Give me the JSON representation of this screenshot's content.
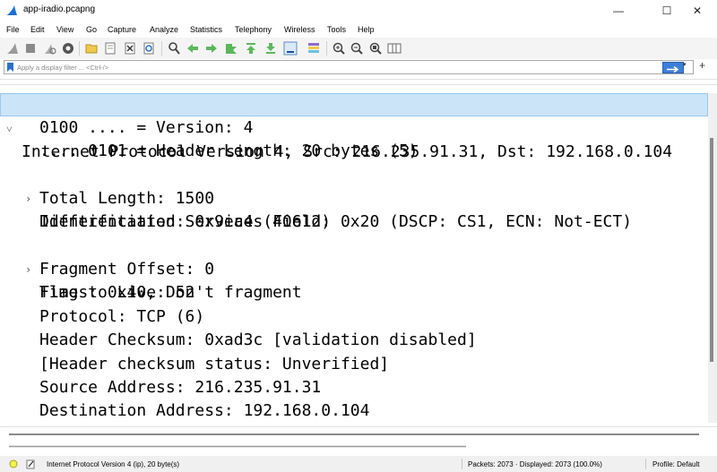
{
  "window": {
    "title": "app-iradio.pcapng",
    "minimize": "—",
    "maximize": "☐",
    "close": "✕"
  },
  "menu": [
    "File",
    "Edit",
    "View",
    "Go",
    "Capture",
    "Analyze",
    "Statistics",
    "Telephony",
    "Wireless",
    "Tools",
    "Help"
  ],
  "filter": {
    "placeholder": "Apply a display filter ... <Ctrl-/>",
    "value": ""
  },
  "details": [
    {
      "text": "Internet Protocol Version 4, Src: 216.235.91.31, Dst: 192.168.0.104",
      "expander": "˅",
      "selected": true
    },
    {
      "text": "0100 .... = Version: 4",
      "expander": ""
    },
    {
      "text": ".... 0101 = Header Length: 20 bytes (5)",
      "expander": ""
    },
    {
      "text": "Differentiated Services Field: 0x20 (DSCP: CS1, ECN: Not-ECT)",
      "expander": "›"
    },
    {
      "text": "Total Length: 1500",
      "expander": ""
    },
    {
      "text": "Identification: 0x9ea4 (40612)",
      "expander": ""
    },
    {
      "text": "Flags: 0x40, Don't fragment",
      "expander": "›"
    },
    {
      "text": "Fragment Offset: 0",
      "expander": ""
    },
    {
      "text": "Time to Live: 52",
      "expander": ""
    },
    {
      "text": "Protocol: TCP (6)",
      "expander": ""
    },
    {
      "text": "Header Checksum: 0xad3c [validation disabled]",
      "expander": ""
    },
    {
      "text": "[Header checksum status: Unverified]",
      "expander": ""
    },
    {
      "text": "Source Address: 216.235.91.31",
      "expander": ""
    },
    {
      "text": "Destination Address: 192.168.0.104",
      "expander": ""
    }
  ],
  "status": {
    "field": "Internet Protocol Version 4 (ip), 20 byte(s)",
    "packets": "Packets: 2073 · Displayed: 2073 (100.0%)",
    "profile": "Profile: Default"
  },
  "colors": {
    "selection": "#cce4f7",
    "accent_blue": "#3d7ed8",
    "green_arrow": "#4caf50"
  },
  "icons": {
    "toolbar": [
      "shark-fin-start-icon",
      "stop-icon",
      "restart-icon",
      "options-gear-icon",
      "open-file-icon",
      "save-file-icon",
      "close-file-icon",
      "reload-icon",
      "find-packet-icon",
      "go-back-icon",
      "go-forward-icon",
      "go-to-packet-icon",
      "first-packet-icon",
      "last-packet-icon",
      "autoscroll-icon",
      "colorize-icon",
      "zoom-in-icon",
      "zoom-out-icon",
      "zoom-normal-icon",
      "resize-columns-icon"
    ]
  }
}
